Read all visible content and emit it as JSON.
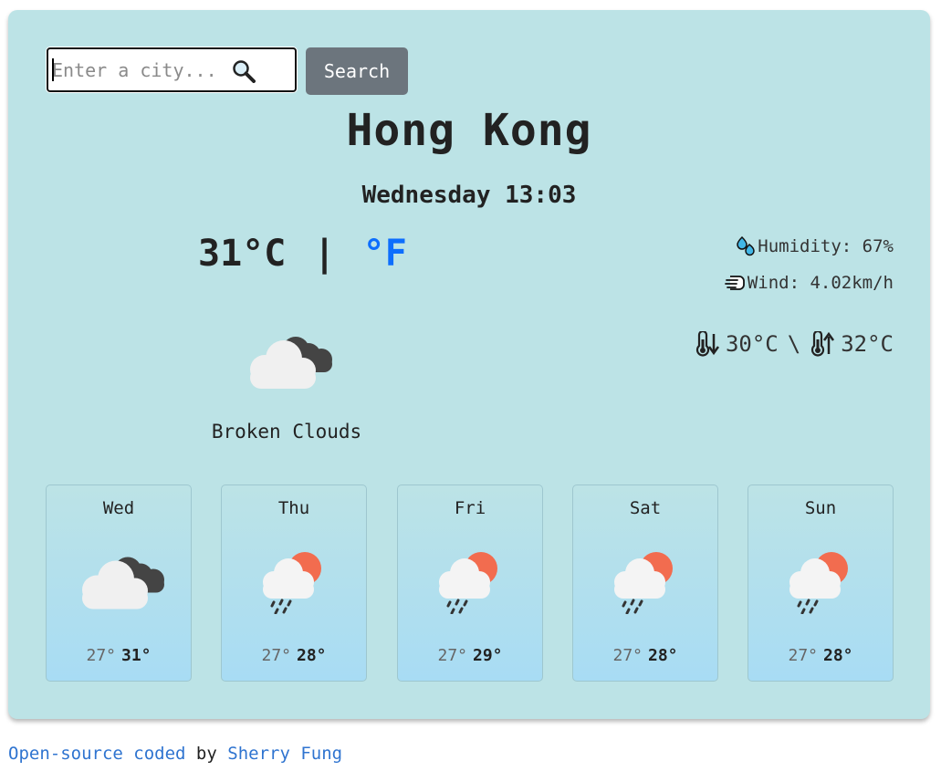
{
  "search": {
    "placeholder": "Enter a city...",
    "value": "",
    "button_label": "Search"
  },
  "current": {
    "city": "Hong Kong",
    "datetime": "Wednesday 13:03",
    "temperature": "31",
    "unit_celsius": "°C",
    "unit_separator": "|",
    "unit_fahrenheit": "°F",
    "humidity": "Humidity: 67%",
    "wind": "Wind: 4.02km/h",
    "min_temp": "30°C",
    "minmax_separator": "\\",
    "max_temp": "32°C",
    "description": "Broken Clouds",
    "icon": "broken-clouds-icon"
  },
  "forecast": [
    {
      "day": "Wed",
      "low": "27°",
      "high": "31°",
      "icon": "broken-clouds-icon"
    },
    {
      "day": "Thu",
      "low": "27°",
      "high": "28°",
      "icon": "rain-sun-icon"
    },
    {
      "day": "Fri",
      "low": "27°",
      "high": "29°",
      "icon": "rain-sun-icon"
    },
    {
      "day": "Sat",
      "low": "27°",
      "high": "28°",
      "icon": "rain-sun-icon"
    },
    {
      "day": "Sun",
      "low": "27°",
      "high": "28°",
      "icon": "rain-sun-icon"
    }
  ],
  "footer": {
    "open_source_link": "Open-source coded",
    "by_text": "by",
    "author_link": "Sherry Fung"
  },
  "colors": {
    "card_background": "#bce3e6",
    "accent_link": "#0d6efd",
    "button": "#6c757d",
    "sun": "#f26c4f",
    "dark_cloud": "#444444",
    "light_cloud": "#f0f0f0"
  }
}
